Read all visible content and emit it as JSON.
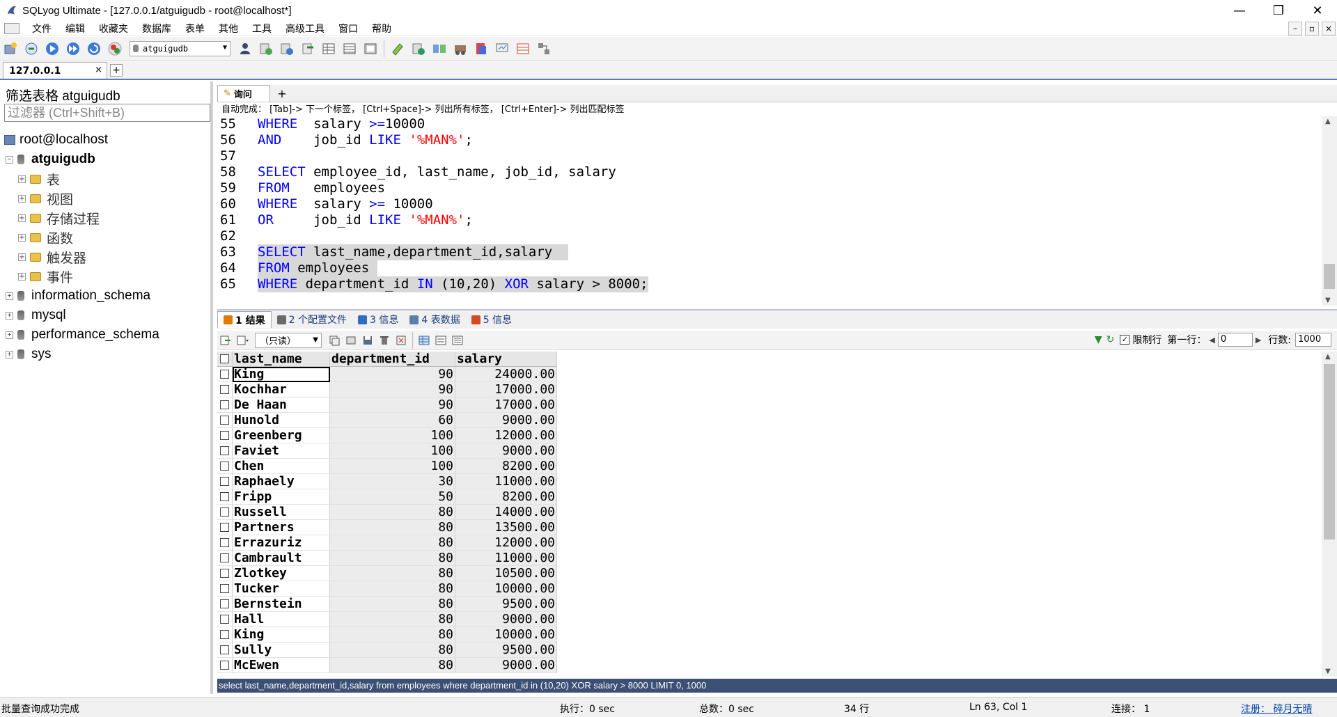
{
  "window": {
    "title": "SQLyog Ultimate - [127.0.0.1/atguigudb - root@localhost*]",
    "minimize": "—",
    "maximize": "❐",
    "close": "✕"
  },
  "menu": {
    "items": [
      "文件",
      "编辑",
      "收藏夹",
      "数据库",
      "表单",
      "其他",
      "工具",
      "高级工具",
      "窗口",
      "帮助"
    ]
  },
  "toolbar": {
    "database_select": "atguigudb"
  },
  "connection_tab": {
    "label": "127.0.0.1",
    "close": "×",
    "add": "+"
  },
  "left_panel": {
    "filter_title": "筛选表格 atguigudb",
    "filter_placeholder": "过滤器 (Ctrl+Shift+B)",
    "tree": {
      "server": "root@localhost",
      "current_db": "atguigudb",
      "children": [
        "表",
        "视图",
        "存储过程",
        "函数",
        "触发器",
        "事件"
      ],
      "other_dbs": [
        "information_schema",
        "mysql",
        "performance_schema",
        "sys"
      ]
    }
  },
  "query_tab": {
    "label": "询问",
    "add": "+",
    "autocomplete_hint": "自动完成： [Tab]-> 下一个标签， [Ctrl+Space]-> 列出所有标签， [Ctrl+Enter]-> 列出匹配标签"
  },
  "editor": {
    "lines": [
      {
        "n": "55",
        "a": "WHERE",
        "b": "  salary ",
        "c": ">=",
        "d": "10000",
        "e": "",
        "f": ""
      },
      {
        "n": "56",
        "a": "AND",
        "b": "    job_id ",
        "c": "LIKE",
        "d": " ",
        "e": "'%MAN%'",
        "f": ";"
      },
      {
        "n": "57",
        "a": "",
        "b": "",
        "c": "",
        "d": "",
        "e": "",
        "f": ""
      },
      {
        "n": "58",
        "a": "SELECT",
        "b": " employee_id, last_name, job_id, salary",
        "c": "",
        "d": "",
        "e": "",
        "f": ""
      },
      {
        "n": "59",
        "a": "FROM",
        "b": "   employees",
        "c": "",
        "d": "",
        "e": "",
        "f": ""
      },
      {
        "n": "60",
        "a": "WHERE",
        "b": "  salary ",
        "c": ">=",
        "d": " 10000",
        "e": "",
        "f": ""
      },
      {
        "n": "61",
        "a": "OR",
        "b": "     job_id ",
        "c": "LIKE",
        "d": " ",
        "e": "'%MAN%'",
        "f": ";"
      },
      {
        "n": "62",
        "a": "",
        "b": "",
        "c": "",
        "d": "",
        "e": "",
        "f": ""
      },
      {
        "n": "63",
        "a": "SELECT",
        "b": " last_name,department_id,salary  ",
        "c": "",
        "d": "",
        "e": "",
        "f": ""
      },
      {
        "n": "64",
        "a": "FROM",
        "b": " employees ",
        "c": "",
        "d": "",
        "e": "",
        "f": ""
      },
      {
        "n": "65",
        "a": "WHERE",
        "b": " department_id ",
        "c": "IN",
        "d": " (10,20) ",
        "e": "XOR",
        "f": " salary > 8000;"
      }
    ]
  },
  "result_tabs": [
    {
      "label": "1 结果",
      "color": "#e07b00"
    },
    {
      "label": "2 个配置文件",
      "color": "#6a6a6a"
    },
    {
      "label": "3 信息",
      "color": "#2f6cc2"
    },
    {
      "label": "4 表数据",
      "color": "#5b7fa8"
    },
    {
      "label": "5 信息",
      "color": "#d14b28"
    }
  ],
  "result_toolbar": {
    "mode": "（只读）",
    "limit_label": "限制行",
    "limit_checked": "✓",
    "first_row_label": "第一行：",
    "first_row_value": "0",
    "row_count_label": "行数:",
    "row_count_value": "1000"
  },
  "grid": {
    "columns": [
      "last_name",
      "department_id",
      "salary"
    ],
    "rows": [
      [
        "King",
        "90",
        "24000.00"
      ],
      [
        "Kochhar",
        "90",
        "17000.00"
      ],
      [
        "De Haan",
        "90",
        "17000.00"
      ],
      [
        "Hunold",
        "60",
        "9000.00"
      ],
      [
        "Greenberg",
        "100",
        "12000.00"
      ],
      [
        "Faviet",
        "100",
        "9000.00"
      ],
      [
        "Chen",
        "100",
        "8200.00"
      ],
      [
        "Raphaely",
        "30",
        "11000.00"
      ],
      [
        "Fripp",
        "50",
        "8200.00"
      ],
      [
        "Russell",
        "80",
        "14000.00"
      ],
      [
        "Partners",
        "80",
        "13500.00"
      ],
      [
        "Errazuriz",
        "80",
        "12000.00"
      ],
      [
        "Cambrault",
        "80",
        "11000.00"
      ],
      [
        "Zlotkey",
        "80",
        "10500.00"
      ],
      [
        "Tucker",
        "80",
        "10000.00"
      ],
      [
        "Bernstein",
        "80",
        "9500.00"
      ],
      [
        "Hall",
        "80",
        "9000.00"
      ],
      [
        "King",
        "80",
        "10000.00"
      ],
      [
        "Sully",
        "80",
        "9500.00"
      ],
      [
        "McEwen",
        "80",
        "9000.00"
      ]
    ]
  },
  "exec_sql": "select last_name,department_id,salary from employees where department_id in (10,20) XOR salary > 8000 LIMIT 0, 1000",
  "status": {
    "message": "批量查询成功完成",
    "exec": "执行：0 sec",
    "total": "总数：0 sec",
    "rows": "34 行",
    "position": "Ln 63, Col 1",
    "connections": "连接： 1",
    "register": "注册： 碎月无晴"
  },
  "colors": {
    "keyword": "#0000ff",
    "string": "#ff0000",
    "selection": "#d8d8d8",
    "exec_bar": "#3c4f74"
  }
}
